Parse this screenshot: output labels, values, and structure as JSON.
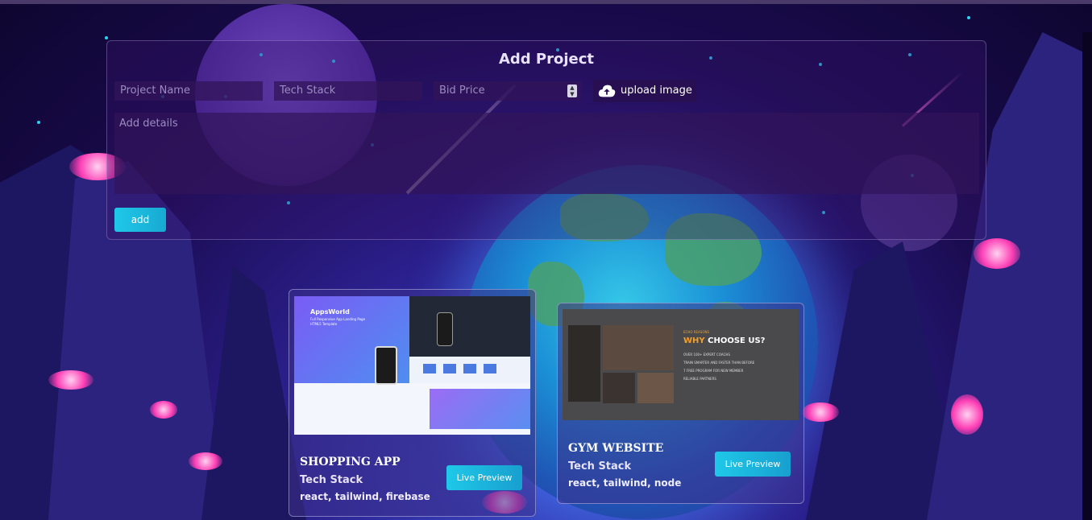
{
  "form": {
    "title": "Add Project",
    "project_name_placeholder": "Project Name",
    "tech_stack_placeholder": "Tech Stack",
    "bid_price_placeholder": "Bid Price",
    "upload_label": "upload image",
    "details_placeholder": "Add details",
    "add_label": "add"
  },
  "thumbnails": {
    "apps": {
      "brand": "AppsWorld",
      "tagline1": "Full Responsive App Landing Page",
      "tagline2": "HTML5 Template"
    },
    "gym": {
      "kicker": "ECHO REASONS",
      "heading_why": "WHY",
      "heading_rest": " CHOOSE US?",
      "bullets": [
        "OVER 100+ EXPERT COACHS",
        "TRAIN SMARTER AND FASTER THAN BEFORE",
        "7 FREE PROGRAM FOR NEW MEMBER",
        "RELIABLE PARTNERS"
      ]
    }
  },
  "projects": [
    {
      "title": "SHOPPING APP",
      "subtitle": "Tech Stack",
      "stack": "react, tailwind, firebase",
      "button": "Live Preview"
    },
    {
      "title": "GYM WEBSITE",
      "subtitle": "Tech Stack",
      "stack": "react, tailwind, node",
      "button": "Live Preview"
    }
  ],
  "colors": {
    "accent": "#1fc8e8",
    "glow": "#ff3fb5"
  }
}
